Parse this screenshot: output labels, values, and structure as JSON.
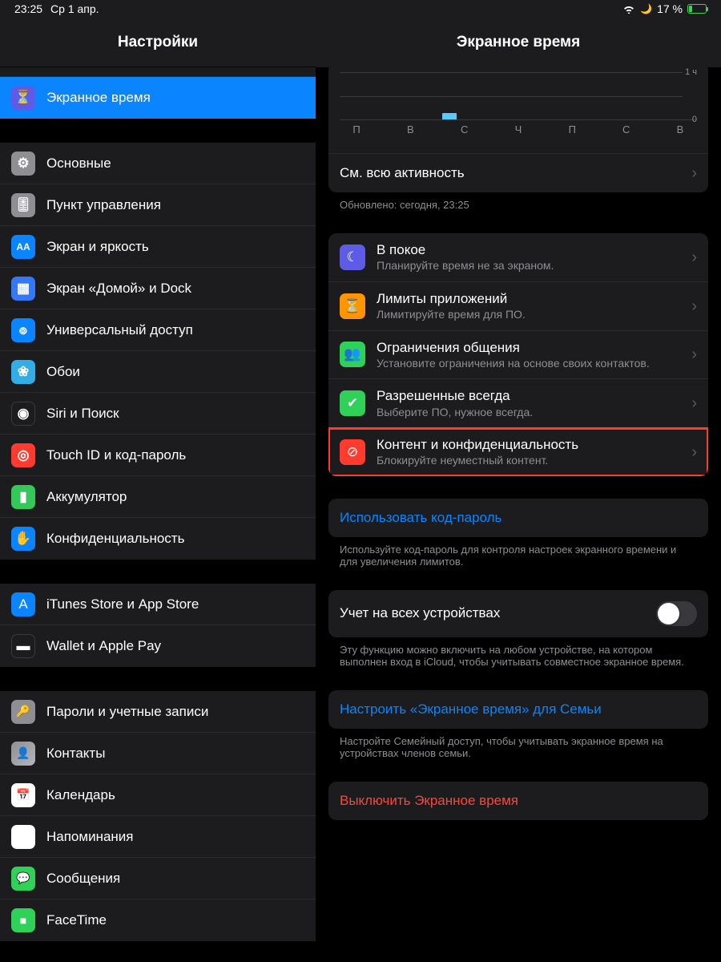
{
  "statusbar": {
    "time": "23:25",
    "date": "Ср 1 апр.",
    "battery_pct": "17 %"
  },
  "sidebar": {
    "title": "Настройки",
    "screen_time": "Экранное время",
    "items": [
      "Основные",
      "Пункт управления",
      "Экран и яркость",
      "Экран «Домой» и Dock",
      "Универсальный доступ",
      "Обои",
      "Siri и Поиск",
      "Touch ID и код-пароль",
      "Аккумулятор",
      "Конфиденциальность"
    ],
    "group2": [
      "iTunes Store и App Store",
      "Wallet и Apple Pay"
    ],
    "group3": [
      "Пароли и учетные записи",
      "Контакты",
      "Календарь",
      "Напоминания",
      "Сообщения",
      "FaceTime"
    ]
  },
  "main": {
    "title": "Экранное время",
    "all_activity": "См. всю активность",
    "updated": "Обновлено: сегодня, 23:25",
    "features": [
      {
        "title": "В покое",
        "sub": "Планируйте время не за экраном."
      },
      {
        "title": "Лимиты приложений",
        "sub": "Лимитируйте время для ПО."
      },
      {
        "title": "Ограничения общения",
        "sub": "Установите ограничения на основе своих контактов."
      },
      {
        "title": "Разрешенные всегда",
        "sub": "Выберите ПО, нужное всегда."
      },
      {
        "title": "Контент и конфиденциальность",
        "sub": "Блокируйте неуместный контент."
      }
    ],
    "use_passcode": "Использовать код-пароль",
    "use_passcode_desc": "Используйте код-пароль для контроля настроек экранного времени и для увеличения лимитов.",
    "all_devices": "Учет на всех устройствах",
    "all_devices_desc": "Эту функцию можно включить на любом устройстве, на котором выполнен вход в iCloud, чтобы учитывать совместное экранное время.",
    "family": "Настроить «Экранное время» для Семьи",
    "family_desc": "Настройте Семейный доступ, чтобы учитывать экранное время на устройствах членов семьи.",
    "turn_off": "Выключить Экранное время"
  },
  "chart_data": {
    "type": "bar",
    "categories": [
      "П",
      "В",
      "С",
      "Ч",
      "П",
      "С",
      "В"
    ],
    "values": [
      0,
      0,
      0.3,
      0,
      0,
      0,
      0
    ],
    "ylabels_visible": [
      "1 ч",
      "0"
    ],
    "ylim": [
      0,
      1.5
    ]
  }
}
